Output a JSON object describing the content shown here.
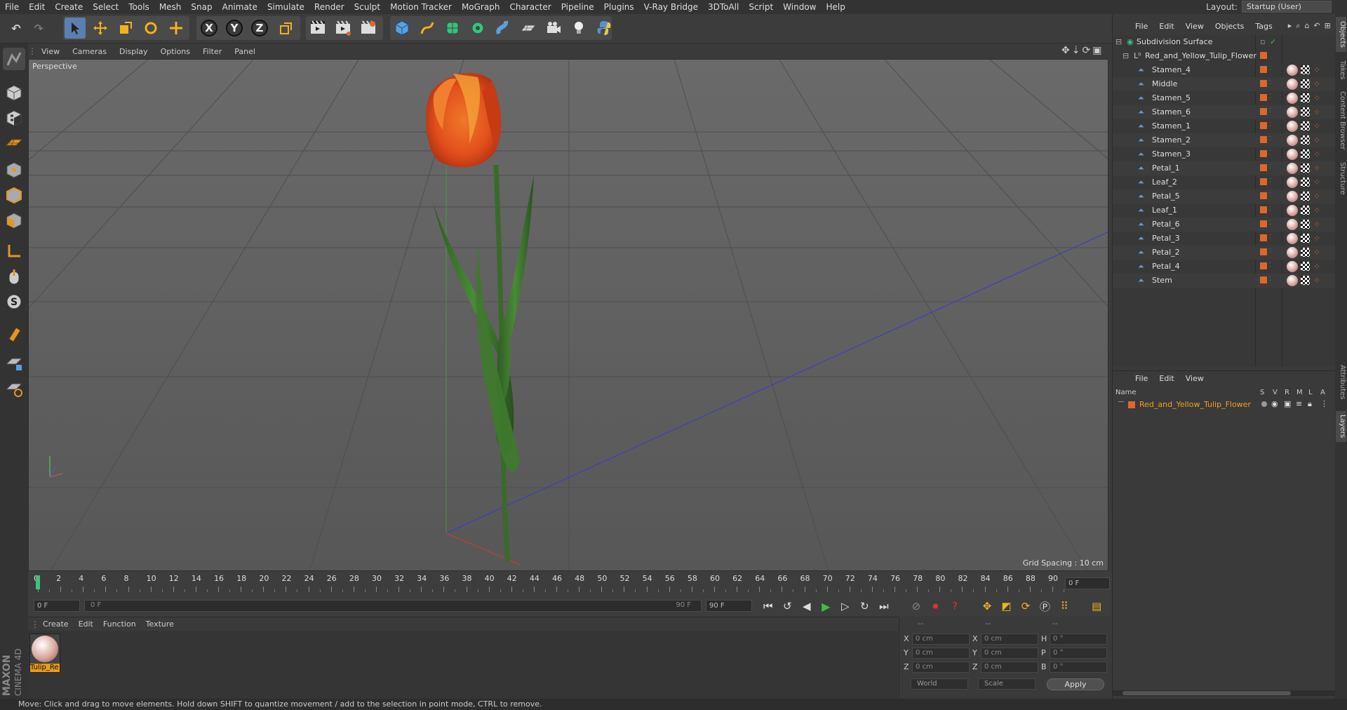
{
  "menubar": {
    "items": [
      "File",
      "Edit",
      "Create",
      "Select",
      "Tools",
      "Mesh",
      "Snap",
      "Animate",
      "Simulate",
      "Render",
      "Sculpt",
      "Motion Tracker",
      "MoGraph",
      "Character",
      "Pipeline",
      "Plugins",
      "V-Ray Bridge",
      "3DToAll",
      "Script",
      "Window",
      "Help"
    ],
    "layout_label": "Layout:",
    "layout_value": "Startup (User)"
  },
  "toolbar": {
    "x_axis": "X",
    "y_axis": "Y",
    "z_axis": "Z"
  },
  "viewport": {
    "menu": [
      "View",
      "Cameras",
      "Display",
      "Options",
      "Filter",
      "Panel"
    ],
    "label": "Perspective",
    "grid_spacing": "Grid Spacing : 10 cm"
  },
  "timeline": {
    "ticks": [
      "0",
      "2",
      "4",
      "6",
      "8",
      "10",
      "12",
      "14",
      "16",
      "18",
      "20",
      "22",
      "24",
      "26",
      "28",
      "30",
      "32",
      "34",
      "36",
      "38",
      "40",
      "42",
      "44",
      "46",
      "48",
      "50",
      "52",
      "54",
      "56",
      "58",
      "60",
      "62",
      "64",
      "66",
      "68",
      "70",
      "72",
      "74",
      "76",
      "78",
      "80",
      "82",
      "84",
      "86",
      "88",
      "90"
    ],
    "current_frame_field": "0 F",
    "start_field": "0 F",
    "range_start": "0 F",
    "range_end": "90 F",
    "end_field": "90 F"
  },
  "material_manager": {
    "menu": [
      "Create",
      "Edit",
      "Function",
      "Texture"
    ],
    "material_name": "Tulip_Re"
  },
  "coords": {
    "header": [
      "--",
      "--",
      "--"
    ],
    "rows": [
      {
        "axis": "X",
        "pos": "0 cm",
        "size_axis": "X",
        "size": "0 cm",
        "rot_axis": "H",
        "rot": "0 °"
      },
      {
        "axis": "Y",
        "pos": "0 cm",
        "size_axis": "Y",
        "size": "0 cm",
        "rot_axis": "P",
        "rot": "0 °"
      },
      {
        "axis": "Z",
        "pos": "0 cm",
        "size_axis": "Z",
        "size": "0 cm",
        "rot_axis": "B",
        "rot": "0 °"
      }
    ],
    "mode1": "World",
    "mode2": "Scale",
    "apply": "Apply"
  },
  "objects": {
    "menu": [
      "File",
      "Edit",
      "View",
      "Objects",
      "Tags"
    ],
    "root": "Subdivision Surface",
    "group": "Red_and_Yellow_Tulip_Flower",
    "children": [
      "Stamen_4",
      "Middle",
      "Stamen_5",
      "Stamen_6",
      "Stamen_1",
      "Stamen_2",
      "Stamen_3",
      "Petal_1",
      "Leaf_2",
      "Petal_5",
      "Leaf_1",
      "Petal_6",
      "Petal_3",
      "Petal_2",
      "Petal_4",
      "Stem"
    ]
  },
  "layers": {
    "menu": [
      "File",
      "Edit",
      "View"
    ],
    "header_name": "Name",
    "header_cols": [
      "S",
      "V",
      "R",
      "M",
      "L",
      "A"
    ],
    "layer_name": "Red_and_Yellow_Tulip_Flower"
  },
  "vertical_tabs": [
    "Objects",
    "Takes",
    "Content Browser",
    "Structure",
    "Attributes",
    "Layers"
  ],
  "status": "Move: Click and drag to move elements. Hold down SHIFT to quantize movement / add to the selection in point mode, CTRL to remove.",
  "brand": {
    "line1": "MAXON",
    "line2": "CINEMA 4D"
  },
  "colors": {
    "accent": "#e0662a",
    "active_tab": "#5a7fb0",
    "play": "#3fbf3f"
  }
}
